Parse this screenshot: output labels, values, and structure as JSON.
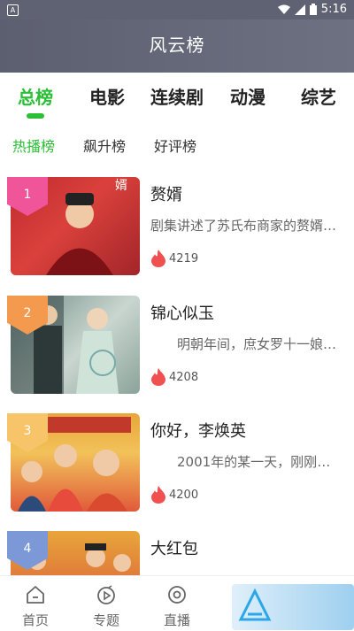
{
  "status_bar": {
    "time": "5:16",
    "notification_icon": "A"
  },
  "header": {
    "title": "风云榜"
  },
  "tabs": [
    {
      "label": "总榜",
      "active": true
    },
    {
      "label": "电影",
      "active": false
    },
    {
      "label": "连续剧",
      "active": false
    },
    {
      "label": "动漫",
      "active": false
    },
    {
      "label": "综艺",
      "active": false
    }
  ],
  "subtabs": [
    {
      "label": "热播榜",
      "active": true
    },
    {
      "label": "飙升榜",
      "active": false
    },
    {
      "label": "好评榜",
      "active": false
    }
  ],
  "items": [
    {
      "rank": "1",
      "title": "赘婿",
      "desc": "剧集讲述了苏氏布商家的赘婿…",
      "hot": "4219",
      "rank_color": "#f0559a"
    },
    {
      "rank": "2",
      "title": "锦心似玉",
      "desc": "　　明朝年间，庶女罗十一娘…",
      "hot": "4208",
      "rank_color": "#f39a4f"
    },
    {
      "rank": "3",
      "title": "你好，李焕英",
      "desc": "　　2001年的某一天，刚刚考…",
      "hot": "4200",
      "rank_color": "#f7c46a"
    },
    {
      "rank": "4",
      "title": "大红包",
      "desc": "",
      "hot": "",
      "rank_color": "#7d98d6"
    }
  ],
  "bottom_nav": [
    {
      "label": "首页",
      "icon": "home-icon"
    },
    {
      "label": "专题",
      "icon": "topic-icon"
    },
    {
      "label": "直播",
      "icon": "live-icon"
    }
  ],
  "colors": {
    "accent": "#2bbf35",
    "header": "#5e6272",
    "hot": "#f05050"
  }
}
